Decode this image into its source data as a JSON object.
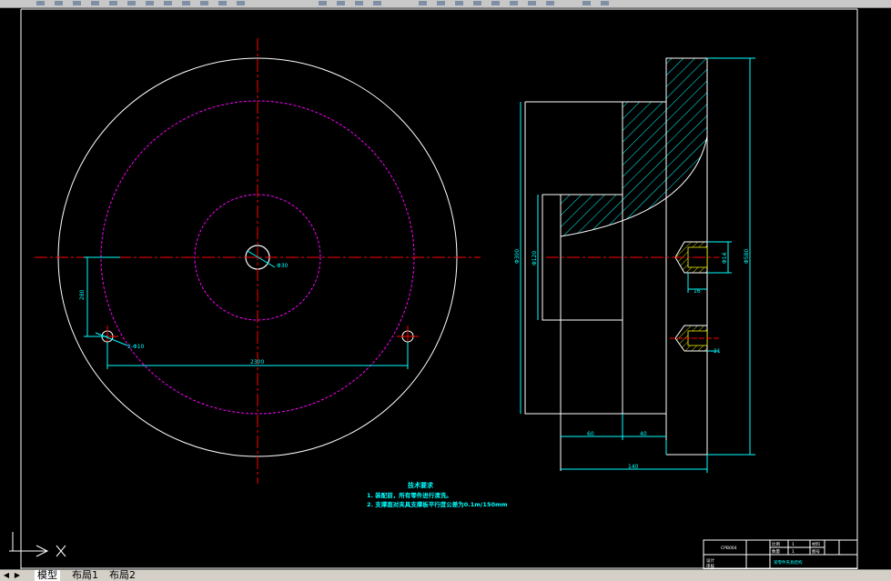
{
  "tabs": [
    {
      "label": "模型",
      "active": true
    },
    {
      "label": "布局1",
      "active": false
    },
    {
      "label": "布局2",
      "active": false
    }
  ],
  "drawing": {
    "notes_title": "技术要求",
    "notes": [
      "1. 装配前，所有零件进行清洗。",
      "2. 支撑面对夹具支撑板平行度公差为0.1m/150mm"
    ],
    "dimensions": {
      "center_hole": "Φ30",
      "small_hole": "2-Φ10",
      "vertical_offset": "280",
      "hole_spacing": "2300",
      "side_overall_height": "Φ300",
      "side_inner_height": "Φ120",
      "outer_right_height": "Φ580",
      "thread_dia": "Φ14",
      "thread_depth": "16",
      "thread_depth_2": "21",
      "width_1": "60",
      "width_2": "40",
      "overall_width": "140"
    },
    "title_block": {
      "drawing_name": "CPB004",
      "part_title": "某零件夹具结构",
      "labels": [
        "设计",
        "审核",
        "比例",
        "数量",
        "材料",
        "图号"
      ],
      "values": [
        "1",
        "1"
      ]
    },
    "colors": {
      "outline": "#ffffff",
      "centerline": "#ff0000",
      "pitch_circle": "#ff00ff",
      "dimension": "#00ffff",
      "hatch": "#00ffff",
      "thread": "#ffff00",
      "notes": "#00ffff"
    }
  }
}
